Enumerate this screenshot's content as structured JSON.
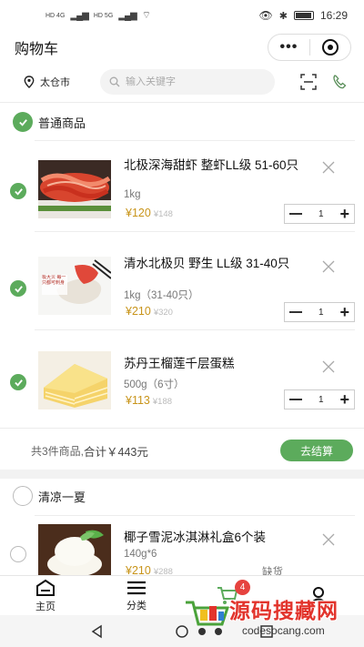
{
  "status_bar": {
    "time": "16:29",
    "network_1": "HD 4G",
    "network_2": "HD 5G"
  },
  "header": {
    "title": "购物车"
  },
  "location": {
    "city": "太仓市"
  },
  "search": {
    "placeholder": "输入关键字"
  },
  "groups": [
    {
      "name": "普通商品",
      "checked": true,
      "items": [
        {
          "name": "北极深海甜虾 整虾LL级 51-60只",
          "spec": "1kg",
          "price": "¥120",
          "original_price": "¥148",
          "quantity": "1",
          "checked": true
        },
        {
          "name": "清水北极贝 野生 LL级 31-40只",
          "spec": "1kg（31-40只）",
          "price": "¥210",
          "original_price": "¥320",
          "quantity": "1",
          "checked": true,
          "image_text": "极大贝 每一只都可刺身"
        },
        {
          "name": "苏丹王榴莲千层蛋糕",
          "spec": "500g（6寸）",
          "price": "¥113",
          "original_price": "¥188",
          "quantity": "1",
          "checked": true
        }
      ],
      "summary": {
        "count_text": "共3件商品,",
        "total_label": "合计￥443元",
        "checkout_label": "去结算"
      }
    },
    {
      "name": "清凉一夏",
      "checked": false,
      "items": [
        {
          "name": "椰子雪泥冰淇淋礼盒6个装",
          "spec": "140g*6",
          "price": "¥210",
          "original_price": "¥288",
          "status": "缺货",
          "checked": false
        }
      ]
    }
  ],
  "tabbar": {
    "items": [
      {
        "label": "主页",
        "icon": "home-icon"
      },
      {
        "label": "分类",
        "icon": "list-icon"
      },
      {
        "label": "",
        "icon": "cart-icon",
        "badge": "4"
      },
      {
        "label": "",
        "icon": "user-icon"
      }
    ]
  },
  "watermark": {
    "text": "源码搜藏网",
    "url": "codesocang.com"
  },
  "colors": {
    "accent_green": "#5cab5c",
    "price": "#c8941a",
    "badge_red": "#e6433f",
    "watermark_red": "#e2342c"
  }
}
